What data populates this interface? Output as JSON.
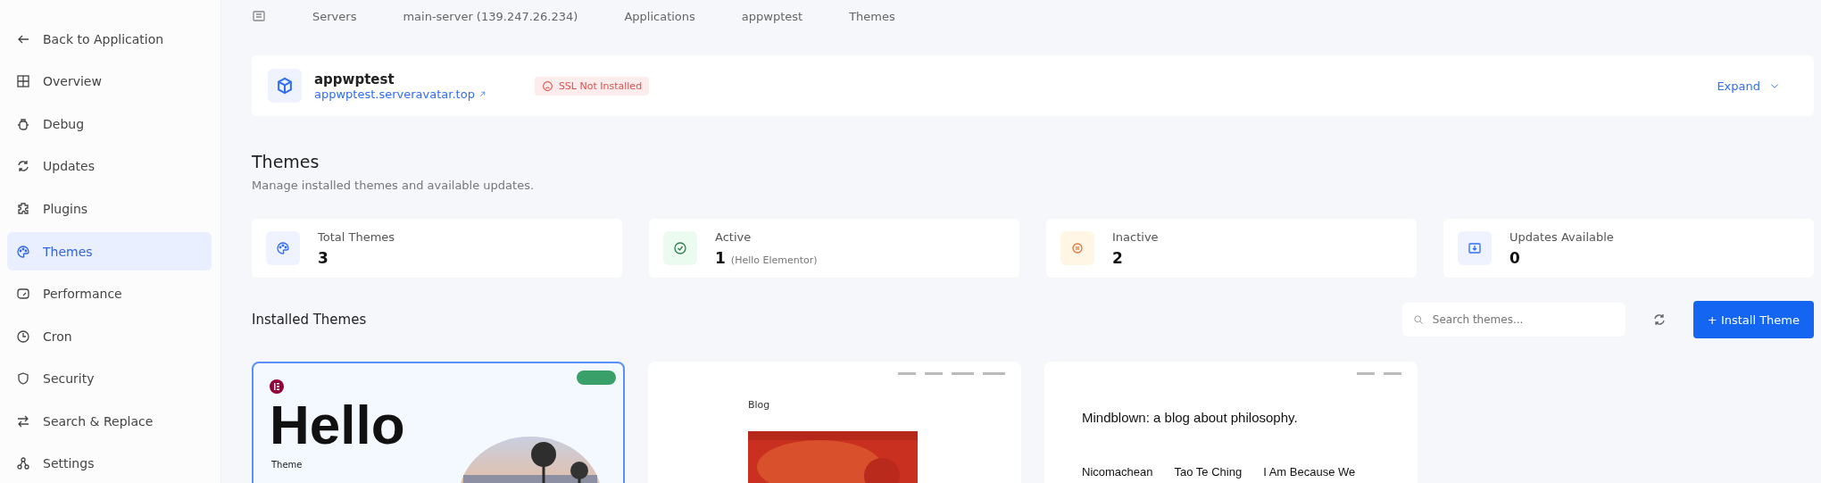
{
  "sidebar": {
    "items": [
      {
        "label": "Back to Application",
        "kind": "back",
        "selected": false
      },
      {
        "label": "Overview",
        "kind": "grid",
        "selected": false
      },
      {
        "label": "Debug",
        "kind": "bug",
        "selected": false
      },
      {
        "label": "Updates",
        "kind": "refresh",
        "selected": false
      },
      {
        "label": "Plugins",
        "kind": "plug",
        "selected": false
      },
      {
        "label": "Themes",
        "kind": "palette",
        "selected": true
      },
      {
        "label": "Performance",
        "kind": "gauge",
        "selected": false
      },
      {
        "label": "Cron",
        "kind": "clock",
        "selected": false
      },
      {
        "label": "Security",
        "kind": "shield",
        "selected": false
      },
      {
        "label": "Search & Replace",
        "kind": "swap",
        "selected": false
      },
      {
        "label": "Settings",
        "kind": "nodes",
        "selected": false
      }
    ]
  },
  "breadcrumb": [
    "Servers",
    "main-server (139.247.26.234)",
    "Applications",
    "appwptest",
    "Themes"
  ],
  "app": {
    "name": "appwptest",
    "url": "appwptest.serveravatar.top",
    "ssl": "SSL Not Installed",
    "expand": "Expand"
  },
  "page": {
    "title": "Themes",
    "subtitle": "Manage installed themes and available updates."
  },
  "stats": [
    {
      "kind": "total",
      "label": "Total Themes",
      "value": "3"
    },
    {
      "kind": "active",
      "label": "Active",
      "value": "1",
      "note": "(Hello Elementor)"
    },
    {
      "kind": "inactive",
      "label": "Inactive",
      "value": "2"
    },
    {
      "kind": "updates",
      "label": "Updates Available",
      "value": "0"
    }
  ],
  "installed": {
    "title": "Installed Themes",
    "search": {
      "placeholder": "Search themes..."
    },
    "install_button": "+ Install Theme"
  },
  "themes": [
    {
      "kind": "hello",
      "selected": true,
      "texts": [
        "Hello",
        "Theme"
      ]
    },
    {
      "kind": "blog",
      "selected": false,
      "texts": [
        "Blog"
      ]
    },
    {
      "kind": "mindblown",
      "selected": false,
      "texts": [
        "Mindblown: a blog about philosophy.",
        "Nicomachean",
        "Tao Te Ching",
        "I Am Because We"
      ]
    }
  ]
}
